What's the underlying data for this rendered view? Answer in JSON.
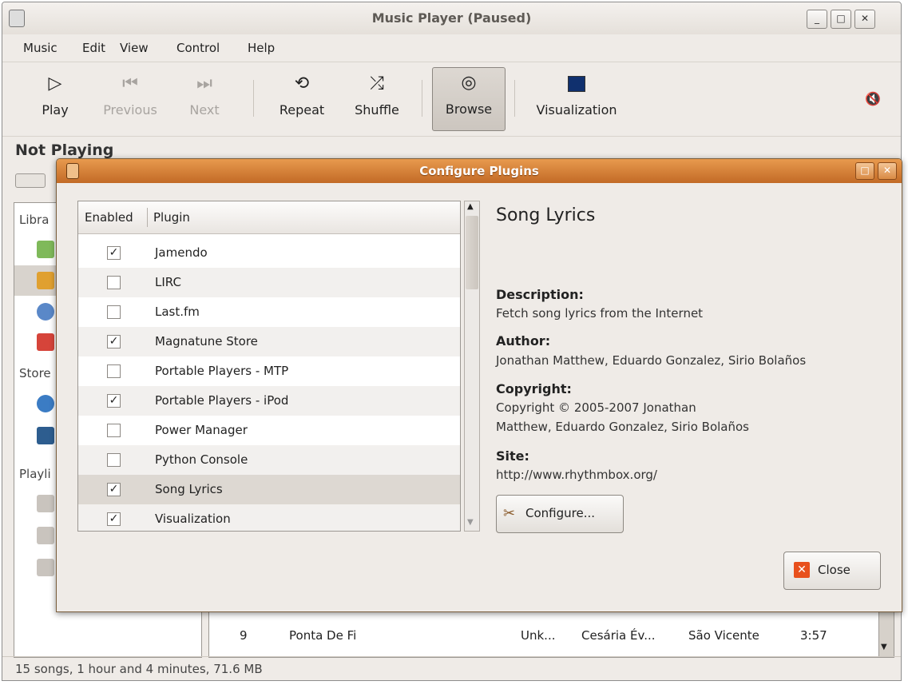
{
  "window": {
    "title": "Music Player (Paused)"
  },
  "menu": [
    "Music",
    "Edit",
    "View",
    "Control",
    "Help"
  ],
  "toolbar": {
    "play": "Play",
    "previous": "Previous",
    "next": "Next",
    "repeat": "Repeat",
    "shuffle": "Shuffle",
    "browse": "Browse",
    "visualization": "Visualization"
  },
  "now_playing": "Not Playing",
  "sidebar": {
    "library": "Libra",
    "stores": "Store",
    "playlists": "Playli"
  },
  "track": {
    "number": "9",
    "title": "Ponta De Fi",
    "genre": "Unk...",
    "artist": "Cesária Év...",
    "album": "São Vicente",
    "time": "3:57"
  },
  "status": "15 songs, 1 hour and 4 minutes, 71.6 MB",
  "dialog": {
    "title": "Configure Plugins",
    "columns": {
      "enabled": "Enabled",
      "plugin": "Plugin"
    },
    "plugins": [
      {
        "name": "Jamendo",
        "enabled": true
      },
      {
        "name": "LIRC",
        "enabled": false
      },
      {
        "name": "Last.fm",
        "enabled": false
      },
      {
        "name": "Magnatune Store",
        "enabled": true
      },
      {
        "name": "Portable Players - MTP",
        "enabled": false
      },
      {
        "name": "Portable Players - iPod",
        "enabled": true
      },
      {
        "name": "Power Manager",
        "enabled": false
      },
      {
        "name": "Python Console",
        "enabled": false
      },
      {
        "name": "Song Lyrics",
        "enabled": true
      },
      {
        "name": "Visualization",
        "enabled": true
      }
    ],
    "selected": "Song Lyrics",
    "heading": "Song Lyrics",
    "description_label": "Description:",
    "description": "Fetch song lyrics from the Internet",
    "author_label": "Author:",
    "author": "Jonathan Matthew, Eduardo Gonzalez, Sirio Bolaños",
    "copyright_label": "Copyright:",
    "copyright_line1": "Copyright © 2005-2007 Jonathan",
    "copyright_line2": "Matthew, Eduardo Gonzalez, Sirio Bolaños",
    "site_label": "Site:",
    "site": "http://www.rhythmbox.org/",
    "configure_label": "Configure...",
    "close_label": "Close"
  },
  "colors": {
    "dialog_titlebar": "#d37e35",
    "selected_row": "#ddd8d2",
    "close_icon": "#e8501c"
  }
}
